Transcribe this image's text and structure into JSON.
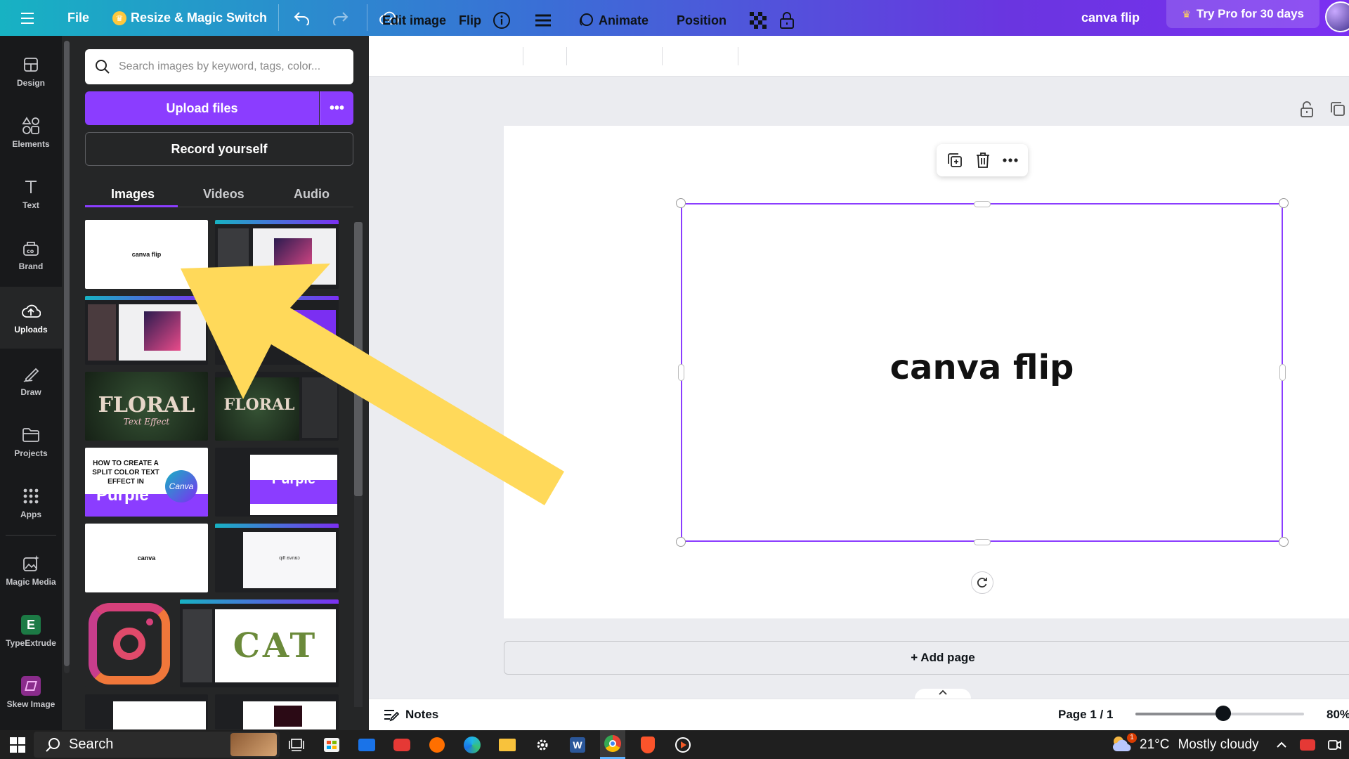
{
  "topbar": {
    "file_label": "File",
    "resize_label": "Resize & Magic Switch",
    "doc_title": "canva flip",
    "try_pro_label": "Try Pro for 30 days"
  },
  "rail": [
    {
      "label": "Design",
      "icon": "design-icon"
    },
    {
      "label": "Elements",
      "icon": "elements-icon"
    },
    {
      "label": "Text",
      "icon": "text-icon"
    },
    {
      "label": "Brand",
      "icon": "brand-icon"
    },
    {
      "label": "Uploads",
      "icon": "uploads-icon"
    },
    {
      "label": "Draw",
      "icon": "draw-icon"
    },
    {
      "label": "Projects",
      "icon": "projects-icon"
    },
    {
      "label": "Apps",
      "icon": "apps-icon"
    },
    {
      "label": "Magic Media",
      "icon": "magic-media-icon"
    },
    {
      "label": "TypeExtrude",
      "icon": "typeextrude-icon"
    },
    {
      "label": "Skew Image",
      "icon": "skew-image-icon"
    }
  ],
  "panel": {
    "search_placeholder": "Search images by keyword, tags, color...",
    "upload_label": "Upload files",
    "record_label": "Record yourself",
    "tabs": [
      "Images",
      "Videos",
      "Audio"
    ],
    "thumbs": {
      "canva_flip": "canva flip",
      "floral": "FLORAL",
      "floral_sub": "Text Effect",
      "split_title": "HOW TO CREATE A SPLIT COLOR TEXT EFFECT IN",
      "purple": "Purple",
      "canva_badge": "Canva",
      "canva": "canva",
      "flip_mirror": "canva flip",
      "cat": "CAT"
    }
  },
  "context_bar": {
    "edit_image": "Edit image",
    "flip": "Flip",
    "animate": "Animate",
    "position": "Position"
  },
  "canvas": {
    "text": "canva flip",
    "add_page": "+ Add page"
  },
  "footer": {
    "notes": "Notes",
    "page_count": "Page 1 / 1",
    "zoom": "80%",
    "zoom_fraction": 0.52
  },
  "taskbar": {
    "search_label": "Search",
    "weather_temp": "21°C",
    "weather_desc": "Mostly cloudy",
    "weather_badge": "1"
  },
  "colors": {
    "accent": "#8b3dff",
    "arrow": "#ffd95a"
  }
}
